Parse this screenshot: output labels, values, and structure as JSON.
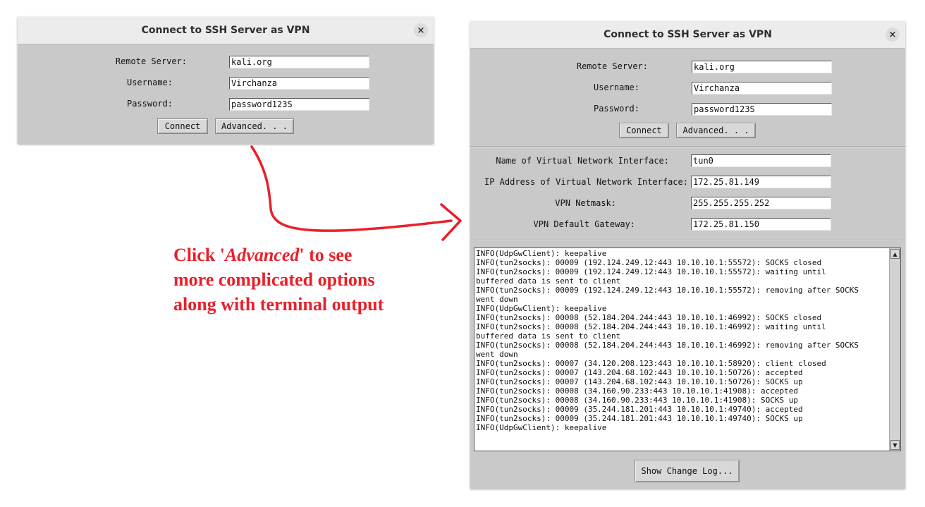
{
  "dialog_simple": {
    "title": "Connect to SSH Server as VPN",
    "close_icon": "×",
    "remote_server_label": "Remote Server:",
    "remote_server_value": "kali.org",
    "username_label": "Username:",
    "username_value": "Virchanza",
    "password_label": "Password:",
    "password_value": "password123S",
    "connect_label": "Connect",
    "advanced_label": "Advanced. . ."
  },
  "dialog_advanced": {
    "title": "Connect to SSH Server as VPN",
    "close_icon": "×",
    "remote_server_label": "Remote Server:",
    "remote_server_value": "kali.org",
    "username_label": "Username:",
    "username_value": "Virchanza",
    "password_label": "Password:",
    "password_value": "password123S",
    "connect_label": "Connect",
    "advanced_label": "Advanced. . .",
    "iface_name_label": "Name of Virtual Network Interface:",
    "iface_name_value": "tun0",
    "iface_ip_label": "IP Address of Virtual Network Interface:",
    "iface_ip_value": "172.25.81.149",
    "netmask_label": "VPN Netmask:",
    "netmask_value": "255.255.255.252",
    "gateway_label": "VPN Default Gateway:",
    "gateway_value": "172.25.81.150",
    "terminal_output": "INFO(UdpGwClient): keepalive\nINFO(tun2socks): 00009 (192.124.249.12:443 10.10.10.1:55572): SOCKS closed\nINFO(tun2socks): 00009 (192.124.249.12:443 10.10.10.1:55572): waiting until\nbuffered data is sent to client\nINFO(tun2socks): 00009 (192.124.249.12:443 10.10.10.1:55572): removing after SOCKS\nwent down\nINFO(UdpGwClient): keepalive\nINFO(tun2socks): 00008 (52.184.204.244:443 10.10.10.1:46992): SOCKS closed\nINFO(tun2socks): 00008 (52.184.204.244:443 10.10.10.1:46992): waiting until\nbuffered data is sent to client\nINFO(tun2socks): 00008 (52.184.204.244:443 10.10.10.1:46992): removing after SOCKS\nwent down\nINFO(tun2socks): 00007 (34.120.208.123:443 10.10.10.1:58920): client closed\nINFO(tun2socks): 00007 (143.204.68.102:443 10.10.10.1:50726): accepted\nINFO(tun2socks): 00007 (143.204.68.102:443 10.10.10.1:50726): SOCKS up\nINFO(tun2socks): 00008 (34.160.90.233:443 10.10.10.1:41908): accepted\nINFO(tun2socks): 00008 (34.160.90.233:443 10.10.10.1:41908): SOCKS up\nINFO(tun2socks): 00009 (35.244.181.201:443 10.10.10.1:49740): accepted\nINFO(tun2socks): 00009 (35.244.181.201:443 10.10.10.1:49740): SOCKS up\nINFO(UdpGwClient): keepalive",
    "show_change_log_label": "Show Change Log..."
  },
  "annotation": {
    "line1_prefix": "Click '",
    "line1_italic": "Advanced",
    "line1_suffix": "' to see",
    "line2": "more complicated options",
    "line3": "along with terminal output",
    "color": "#e8202a"
  },
  "icons": {
    "close": "close-icon",
    "scroll_up": "scroll-up-arrow-icon",
    "scroll_down": "scroll-down-arrow-icon",
    "arrow": "curved-arrow-icon"
  }
}
